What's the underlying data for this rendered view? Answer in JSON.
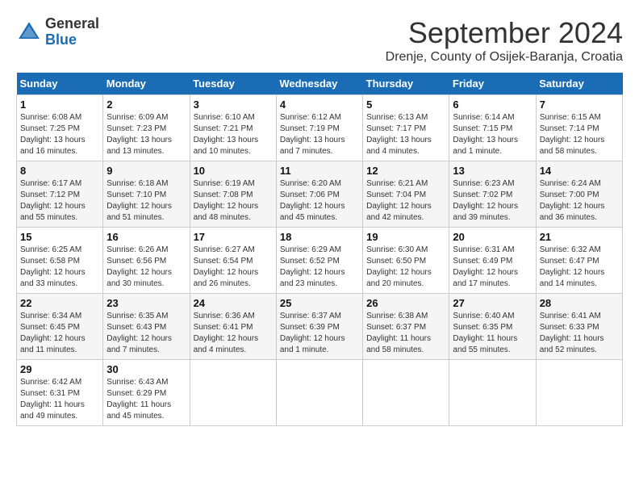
{
  "header": {
    "logo_general": "General",
    "logo_blue": "Blue",
    "month_title": "September 2024",
    "location": "Drenje, County of Osijek-Baranja, Croatia"
  },
  "days_of_week": [
    "Sunday",
    "Monday",
    "Tuesday",
    "Wednesday",
    "Thursday",
    "Friday",
    "Saturday"
  ],
  "weeks": [
    [
      {
        "day": "1",
        "info": "Sunrise: 6:08 AM\nSunset: 7:25 PM\nDaylight: 13 hours and 16 minutes."
      },
      {
        "day": "2",
        "info": "Sunrise: 6:09 AM\nSunset: 7:23 PM\nDaylight: 13 hours and 13 minutes."
      },
      {
        "day": "3",
        "info": "Sunrise: 6:10 AM\nSunset: 7:21 PM\nDaylight: 13 hours and 10 minutes."
      },
      {
        "day": "4",
        "info": "Sunrise: 6:12 AM\nSunset: 7:19 PM\nDaylight: 13 hours and 7 minutes."
      },
      {
        "day": "5",
        "info": "Sunrise: 6:13 AM\nSunset: 7:17 PM\nDaylight: 13 hours and 4 minutes."
      },
      {
        "day": "6",
        "info": "Sunrise: 6:14 AM\nSunset: 7:15 PM\nDaylight: 13 hours and 1 minute."
      },
      {
        "day": "7",
        "info": "Sunrise: 6:15 AM\nSunset: 7:14 PM\nDaylight: 12 hours and 58 minutes."
      }
    ],
    [
      {
        "day": "8",
        "info": "Sunrise: 6:17 AM\nSunset: 7:12 PM\nDaylight: 12 hours and 55 minutes."
      },
      {
        "day": "9",
        "info": "Sunrise: 6:18 AM\nSunset: 7:10 PM\nDaylight: 12 hours and 51 minutes."
      },
      {
        "day": "10",
        "info": "Sunrise: 6:19 AM\nSunset: 7:08 PM\nDaylight: 12 hours and 48 minutes."
      },
      {
        "day": "11",
        "info": "Sunrise: 6:20 AM\nSunset: 7:06 PM\nDaylight: 12 hours and 45 minutes."
      },
      {
        "day": "12",
        "info": "Sunrise: 6:21 AM\nSunset: 7:04 PM\nDaylight: 12 hours and 42 minutes."
      },
      {
        "day": "13",
        "info": "Sunrise: 6:23 AM\nSunset: 7:02 PM\nDaylight: 12 hours and 39 minutes."
      },
      {
        "day": "14",
        "info": "Sunrise: 6:24 AM\nSunset: 7:00 PM\nDaylight: 12 hours and 36 minutes."
      }
    ],
    [
      {
        "day": "15",
        "info": "Sunrise: 6:25 AM\nSunset: 6:58 PM\nDaylight: 12 hours and 33 minutes."
      },
      {
        "day": "16",
        "info": "Sunrise: 6:26 AM\nSunset: 6:56 PM\nDaylight: 12 hours and 30 minutes."
      },
      {
        "day": "17",
        "info": "Sunrise: 6:27 AM\nSunset: 6:54 PM\nDaylight: 12 hours and 26 minutes."
      },
      {
        "day": "18",
        "info": "Sunrise: 6:29 AM\nSunset: 6:52 PM\nDaylight: 12 hours and 23 minutes."
      },
      {
        "day": "19",
        "info": "Sunrise: 6:30 AM\nSunset: 6:50 PM\nDaylight: 12 hours and 20 minutes."
      },
      {
        "day": "20",
        "info": "Sunrise: 6:31 AM\nSunset: 6:49 PM\nDaylight: 12 hours and 17 minutes."
      },
      {
        "day": "21",
        "info": "Sunrise: 6:32 AM\nSunset: 6:47 PM\nDaylight: 12 hours and 14 minutes."
      }
    ],
    [
      {
        "day": "22",
        "info": "Sunrise: 6:34 AM\nSunset: 6:45 PM\nDaylight: 12 hours and 11 minutes."
      },
      {
        "day": "23",
        "info": "Sunrise: 6:35 AM\nSunset: 6:43 PM\nDaylight: 12 hours and 7 minutes."
      },
      {
        "day": "24",
        "info": "Sunrise: 6:36 AM\nSunset: 6:41 PM\nDaylight: 12 hours and 4 minutes."
      },
      {
        "day": "25",
        "info": "Sunrise: 6:37 AM\nSunset: 6:39 PM\nDaylight: 12 hours and 1 minute."
      },
      {
        "day": "26",
        "info": "Sunrise: 6:38 AM\nSunset: 6:37 PM\nDaylight: 11 hours and 58 minutes."
      },
      {
        "day": "27",
        "info": "Sunrise: 6:40 AM\nSunset: 6:35 PM\nDaylight: 11 hours and 55 minutes."
      },
      {
        "day": "28",
        "info": "Sunrise: 6:41 AM\nSunset: 6:33 PM\nDaylight: 11 hours and 52 minutes."
      }
    ],
    [
      {
        "day": "29",
        "info": "Sunrise: 6:42 AM\nSunset: 6:31 PM\nDaylight: 11 hours and 49 minutes."
      },
      {
        "day": "30",
        "info": "Sunrise: 6:43 AM\nSunset: 6:29 PM\nDaylight: 11 hours and 45 minutes."
      },
      {
        "day": "",
        "info": ""
      },
      {
        "day": "",
        "info": ""
      },
      {
        "day": "",
        "info": ""
      },
      {
        "day": "",
        "info": ""
      },
      {
        "day": "",
        "info": ""
      }
    ]
  ]
}
